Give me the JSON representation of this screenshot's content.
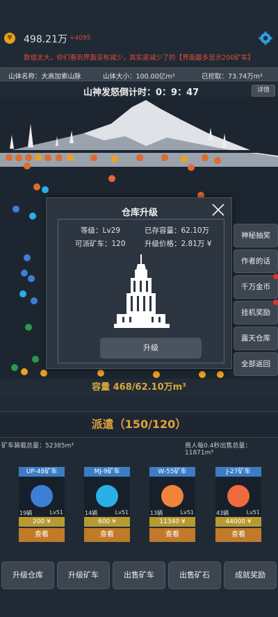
{
  "topbar": {
    "coin_glyph": "¥",
    "gold": "498.21万",
    "gold_delta": "+4095"
  },
  "notice": "数值太大，你们看到界面没有减少，其实是减少了的【界面最多显示200矿车】",
  "info": {
    "mountain_name": "山体名称：大高加索山脉",
    "mountain_size": "山体大小：100.00亿m³",
    "mined": "已挖取：73.74万m³"
  },
  "countdown": "山神发怒倒计时：0：9：47",
  "detail_label": "详情",
  "panel": {
    "title": "仓库升级",
    "level": "等级：Lv29",
    "stored": "已存容量：62.10万",
    "dispatchable": "可派矿车：120",
    "upgrade_price": "升级价格：2.81万 ¥",
    "upgrade_button": "升级"
  },
  "side_buttons": [
    "神秘抽奖",
    "作者的话",
    "千万金币",
    "挂机奖励",
    "露天仓库",
    "全部返回"
  ],
  "capacity": "容量 468/62.10万m³",
  "dispatch": "派遣（150/120）",
  "load_total": "矿车装载总量：52385m³",
  "sell_total": "商人每0.4秒出售总量：11871m³",
  "cards": [
    {
      "name": "UP-48矿车",
      "count": "19辆",
      "level": "Lv51",
      "price": "200 ¥",
      "view": "查看",
      "color": "#3d7fd6"
    },
    {
      "name": "MJ-9矿车",
      "count": "14辆",
      "level": "Lv51",
      "price": "600 ¥",
      "view": "查看",
      "color": "#2ab0e8"
    },
    {
      "name": "W-55矿车",
      "count": "13辆",
      "level": "Lv51",
      "price": "11340 ¥",
      "view": "查看",
      "color": "#f0843a"
    },
    {
      "name": "J-27矿车",
      "count": "43辆",
      "level": "Lv51",
      "price": "44000 ¥",
      "view": "查看",
      "color": "#ef6a3e"
    }
  ],
  "bottom_buttons": [
    "升级仓库",
    "升级矿车",
    "出售矿车",
    "出售矿石",
    "成就奖励"
  ]
}
